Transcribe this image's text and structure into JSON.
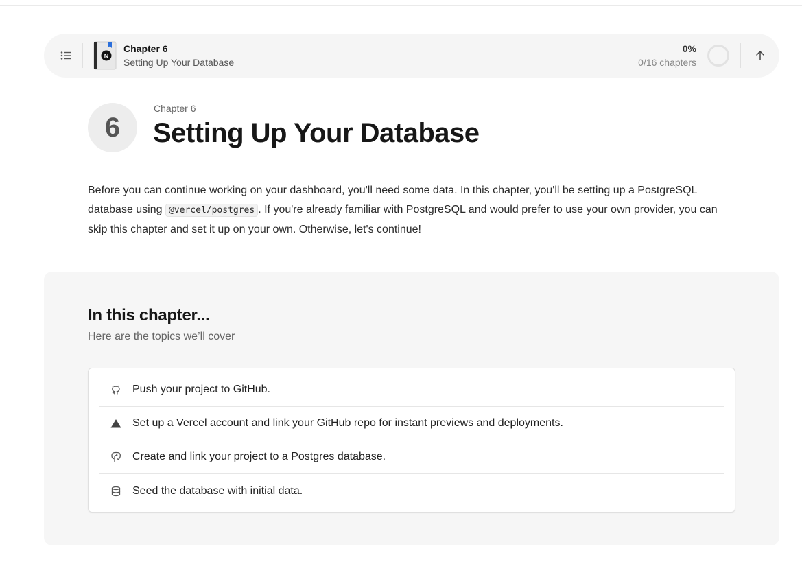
{
  "course_bar": {
    "chapter": "Chapter 6",
    "title": "Setting Up Your Database",
    "progress_percent": "0%",
    "progress_count": "0/16 chapters",
    "progress_value": 0
  },
  "chapter": {
    "number": "6",
    "label": "Chapter 6",
    "title": "Setting Up Your Database",
    "intro_before": "Before you can continue working on your dashboard, you'll need some data. In this chapter, you'll be setting up a PostgreSQL database using ",
    "intro_code": "@vercel/postgres",
    "intro_after": ". If you're already familiar with PostgreSQL and would prefer to use your own provider, you can skip this chapter and set it up on your own. Otherwise, let's continue!"
  },
  "overview": {
    "title": "In this chapter...",
    "subtitle": "Here are the topics we’ll cover",
    "topics": [
      {
        "icon": "github-icon",
        "text": "Push your project to GitHub."
      },
      {
        "icon": "vercel-triangle-icon",
        "text": "Set up a Vercel account and link your GitHub repo for instant previews and deployments."
      },
      {
        "icon": "postgres-elephant-icon",
        "text": "Create and link your project to a Postgres database."
      },
      {
        "icon": "database-icon",
        "text": "Seed the database with initial data."
      }
    ]
  }
}
